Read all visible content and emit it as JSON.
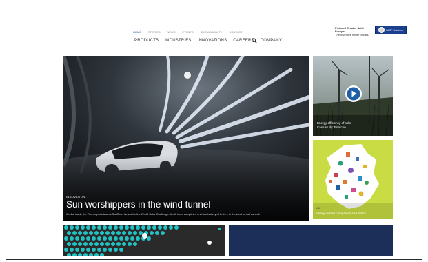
{
  "nav": {
    "sub_items": [
      "HOME",
      "STORIES",
      "NEWS",
      "EVENTS",
      "SUSTAINABILITY",
      "CONTACT"
    ],
    "main_items": [
      "PRODUCTS",
      "INDUSTRIES",
      "INNOVATIONS",
      "CAREERS",
      "COMPANY"
    ]
  },
  "brand": {
    "tagline_line1": "Pictured Creator Sails Europe",
    "tagline_line2": "The Inventive future of cars",
    "logo_text": "BASF Solutions"
  },
  "hero": {
    "category": "INNOVATION",
    "title": "Sun worshippers in the wind tunnel",
    "subtitle": "On the track, the Thermopolis team’s SunRider heads for the World Solar Challenge. It will have completed a whole battery of tests – in the wind tunnel as well."
  },
  "tile1": {
    "caption_line1": "Energy efficiency of solar",
    "caption_line2": "Case study: Enercon"
  },
  "tile2": {
    "category": "MAP",
    "caption": "Family-owned companies and SMEs"
  },
  "colors": {
    "accent": "#1f4fa0",
    "brand_blue": "#1a3f8f",
    "tile_green": "#c9dc43",
    "band_navy": "#1b2f58",
    "dots_teal": "#22c1c3"
  },
  "icons": {
    "search": "search-icon",
    "play": "play-icon",
    "seal": "seal-icon"
  }
}
